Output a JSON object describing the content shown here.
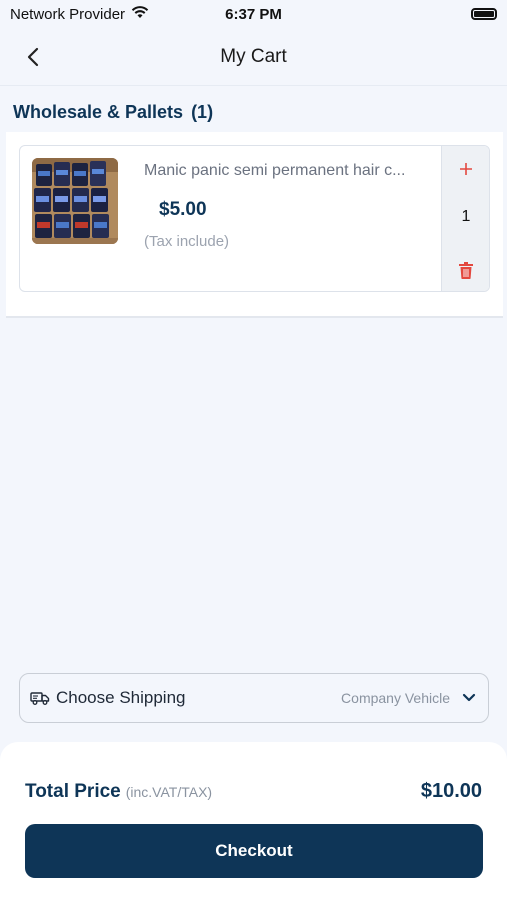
{
  "status_bar": {
    "carrier": "Network Provider",
    "time": "6:37 PM"
  },
  "nav": {
    "title": "My Cart"
  },
  "section": {
    "title": "Wholesale & Pallets",
    "count": "(1)"
  },
  "cart_items": [
    {
      "name": "Manic panic semi permanent hair c...",
      "price": "$5.00",
      "tax_note": "(Tax include)",
      "quantity": "1"
    }
  ],
  "shipping": {
    "label": "Choose Shipping",
    "value": "Company Vehicle"
  },
  "footer": {
    "total_label": "Total Price",
    "total_sub": "(inc.VAT/TAX)",
    "total_amount": "$10.00",
    "checkout_label": "Checkout"
  },
  "colors": {
    "primary": "#0e3557",
    "accent_red": "#e3483f",
    "background": "#f3f6fc"
  },
  "icons": {
    "wifi": "wifi-icon",
    "battery": "battery-icon",
    "back": "chevron-left-icon",
    "plus": "plus-icon",
    "delete": "trash-icon",
    "truck": "truck-icon",
    "dropdown": "chevron-down-icon"
  }
}
